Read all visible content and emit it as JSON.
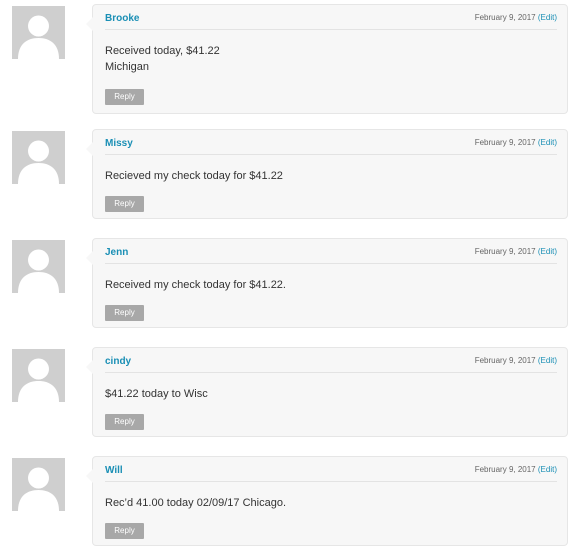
{
  "comments": [
    {
      "author": "Brooke",
      "date": "February 9, 2017",
      "edit_label": "(Edit)",
      "text_lines": [
        "Received today, $41.22",
        "Michigan"
      ],
      "reply_label": "Reply"
    },
    {
      "author": "Missy",
      "date": "February 9, 2017",
      "edit_label": "(Edit)",
      "text_lines": [
        "Recieved my check today for $41.22"
      ],
      "reply_label": "Reply"
    },
    {
      "author": "Jenn",
      "date": "February 9, 2017",
      "edit_label": "(Edit)",
      "text_lines": [
        "Received my check today for $41.22."
      ],
      "reply_label": "Reply"
    },
    {
      "author": "cindy",
      "date": "February 9, 2017",
      "edit_label": "(Edit)",
      "text_lines": [
        "$41.22 today to Wisc"
      ],
      "reply_label": "Reply"
    },
    {
      "author": "Will",
      "date": "February 9, 2017",
      "edit_label": "(Edit)",
      "text_lines": [
        "Rec’d 41.00 today 02/09/17 Chicago."
      ],
      "reply_label": "Reply"
    }
  ],
  "colors": {
    "author_link": "#1a8fb5",
    "reply_button": "#a8a8a8",
    "avatar_bg": "#cfcfcf"
  }
}
